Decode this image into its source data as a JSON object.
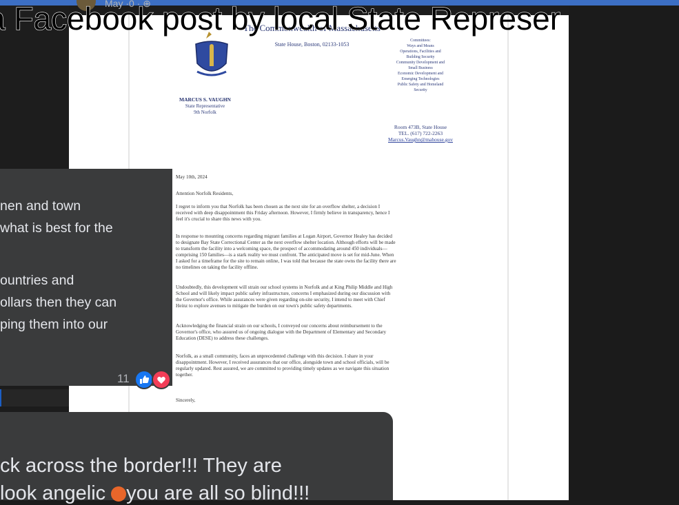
{
  "header": {
    "post_meta": "May ·0 · ⊕",
    "caption": "a Facebook post by local State Represer"
  },
  "letter": {
    "letterhead_title": "The Commonwealth of Massachusetts",
    "address": "State House, Boston, 02133-1053",
    "rep_name": "MARCUS S. VAUGHN",
    "rep_title": "State Representative",
    "rep_district": "9th Norfolk",
    "committees": [
      "Committees:",
      "Ways and Means",
      "Operations, Facilities and",
      "Building Security",
      "Community Development and",
      "Small Business",
      "Economic Development and",
      "Emerging Technologies",
      "Public Safety and Homeland",
      "Security"
    ],
    "office_room": "Room 473B, State House",
    "office_tel": "TEL. (617) 722-2263",
    "office_email": "Marcus.Vaughn@mahouse.gov",
    "date": "May 10th, 2024",
    "salutation": "Attention Norfolk Residents,",
    "paragraphs": [
      [
        "I regret to inform you that Norfolk has been chosen as the next site for an overflow shelter, a decision I",
        "received with deep disappointment this Friday afternoon. However, I firmly believe in transparency, hence I",
        "feel it's crucial to share this news with you."
      ],
      [
        "In response to mounting concerns regarding migrant families at Logan Airport, Governor Healey has decided",
        "to designate Bay State Correctional Center as the next overflow shelter location. Although efforts will be made",
        "to transform the facility into a welcoming space, the prospect of accommodating around 450 individuals—",
        "comprising 150 families—is a stark reality we must confront. The anticipated move is set for mid-June. When",
        "I asked for a timeframe for the site to remain online, I was told that because the state owns the facility there are",
        "no timelines on taking the facility offline."
      ],
      [
        "Undoubtedly, this development will strain our school systems in Norfolk and at King Philip Middle and High",
        "School and will likely impact public safety infrastructure, concerns I emphasized during our discussion with",
        "the Governor's office. While assurances were given regarding on-site security, I intend to meet with Chief",
        "Heinz to explore avenues to mitigate the burden on our town's public safety departments."
      ],
      [
        "Acknowledging the financial strain on our schools, I conveyed our concerns about reimbursement to the",
        "Governor's office, who assured us of ongoing dialogue with the Department of Elementary and Secondary",
        "Education (DESE) to address these challenges."
      ],
      [
        "Norfolk, as a small community, faces an unprecedented challenge with this decision. I share in your",
        "disappointment. However, I received assurances that our office, alongside town and school officials, will be",
        "regularly updated. Rest assured, we are committed to providing timely updates as we navigate this situation",
        "together."
      ]
    ],
    "closing": "Sincerely,"
  },
  "comment1": {
    "lines": [
      "nen and town",
      "what is best for the",
      "",
      "ountries and",
      "ollars then they can",
      "ping them into our"
    ],
    "reaction_count": "11"
  },
  "comment2": {
    "line1": "ck across the border!!! They are",
    "line2a": "look angelic ",
    "line2b": "you are all so blind!!!"
  }
}
